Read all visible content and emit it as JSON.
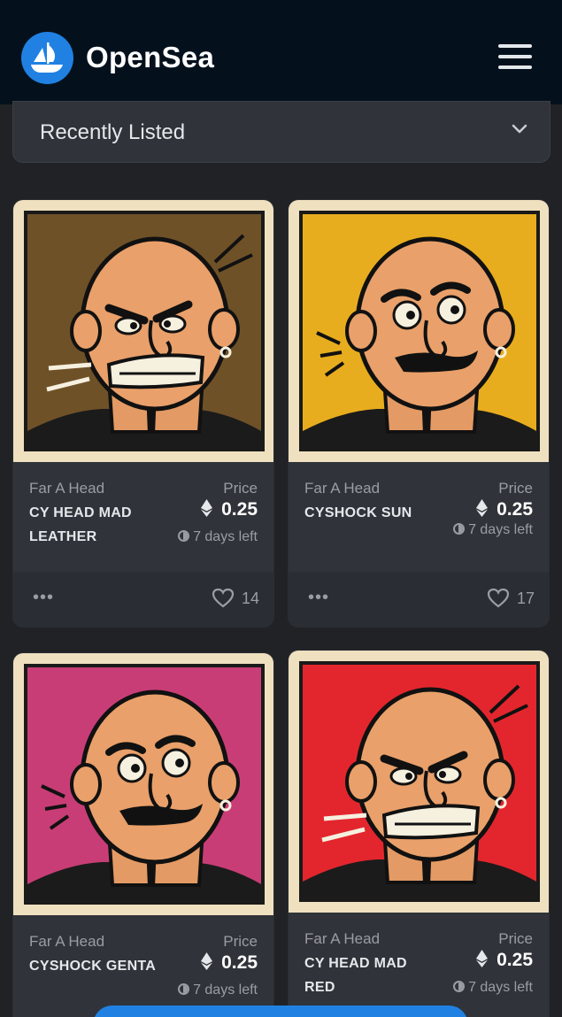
{
  "header": {
    "brand": "OpenSea",
    "logo_icon": "opensea-boat-icon",
    "menu_icon": "hamburger-menu-icon"
  },
  "sort": {
    "label": "Recently Listed",
    "icon": "chevron-down-icon"
  },
  "cards": [
    {
      "collection": "Far A Head",
      "name": "CY HEAD MAD LEATHER",
      "price_label": "Price",
      "price": "0.25",
      "days_left": "7 days left",
      "likes": "14",
      "more": "•••",
      "bg_color": "#6f5128",
      "expression": "angry"
    },
    {
      "collection": "Far A Head",
      "name": "CYSHOCK SUN",
      "price_label": "Price",
      "price": "0.25",
      "days_left": "7 days left",
      "likes": "17",
      "more": "•••",
      "bg_color": "#e8ad1e",
      "expression": "shock"
    },
    {
      "collection": "Far A Head",
      "name": "CYSHOCK GENTA",
      "price_label": "Price",
      "price": "0.25",
      "days_left": "7 days left",
      "bg_color": "#c93d76",
      "expression": "shock"
    },
    {
      "collection": "Far A Head",
      "name": "CY HEAD MAD RED",
      "price_label": "Price",
      "price": "0.25",
      "days_left": "7 days left",
      "bg_color": "#e3262d",
      "expression": "angry"
    }
  ],
  "colors": {
    "accent": "#2081e2",
    "topbar": "#04111d",
    "card": "#303339",
    "page": "#202225"
  }
}
